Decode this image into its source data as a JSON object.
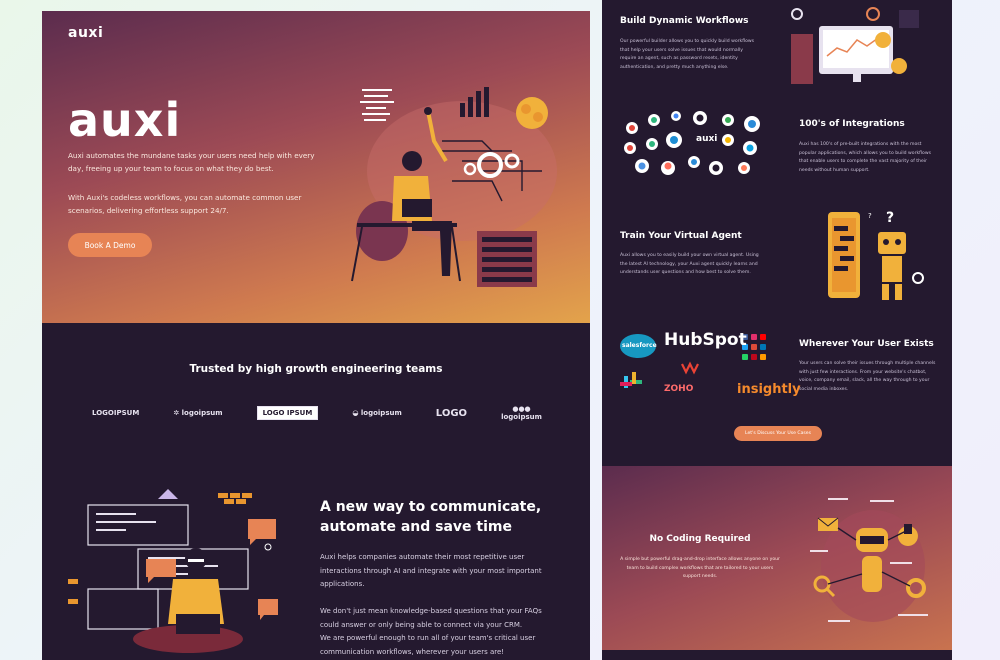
{
  "hero": {
    "nav_logo": "auxi",
    "big_logo": "auxi",
    "para1": "Auxi automates the mundane tasks your users need help with every day, freeing up your team to focus on what they do best.",
    "para2": "With Auxi's codeless workflows, you can automate common user scenarios, delivering effortless support 24/7.",
    "cta": "Book A Demo"
  },
  "trusted": {
    "title": "Trusted by high growth engineering teams",
    "logos": [
      "LOGOIPSUM",
      "logoipsum",
      "LOGO IPSUM",
      "logoipsum",
      "LOGO",
      "logoipsum"
    ]
  },
  "communicate": {
    "title_line1": "A new way to communicate,",
    "title_line2": "automate and save time",
    "para1": "Auxi helps companies automate their most repetitive user interactions through AI and integrate with your most important applications.",
    "para2": "We don't just mean knowledge-based questions that your FAQs could answer or only being able to connect via your CRM.",
    "para3": "We are powerful enough to run all of your team's critical user communication workflows, wherever your users are!"
  },
  "features": {
    "workflows": {
      "title": "Build Dynamic Workflows",
      "text": "Our powerful builder allows you to quickly build workflows that help your users solve issues that would normally require an agent, such as password resets, identity authentication, and pretty much anything else."
    },
    "integrations": {
      "title": "100's of Integrations",
      "text": "Auxi has 100's of pre-built integrations with the most popular applications, which allows you to build workflows that enable users to complete the vast majority of their needs without human support.",
      "center_logo": "auxi"
    },
    "agent": {
      "title": "Train Your Virtual Agent",
      "text": "Auxi allows you to easily build your own virtual agent. Using the latest AI technology, your Auxi agent quickly learns and understands user questions and how best to solve them."
    },
    "wherever": {
      "title": "Wherever Your User Exists",
      "text": "Your users can solve their issues through multiple channels with just few interactions. From your website's chatbot, voice, company email, slack, all the way through to your social media inboxes.",
      "brands": [
        "salesforce",
        "HubSpot",
        "ZOHO",
        "insightly"
      ]
    },
    "usecase_cta": "Let's Discuss Your Use Cases",
    "nocode": {
      "title": "No Coding Required",
      "text": "A simple but powerful drag-and-drop interface allows anyone on your team to build complex workflows that are tailored to your users support needs."
    }
  },
  "colors": {
    "accent": "#e78455",
    "dark": "#24192f",
    "hero_top": "#5b2c4e",
    "hero_bottom": "#e3a34b"
  }
}
